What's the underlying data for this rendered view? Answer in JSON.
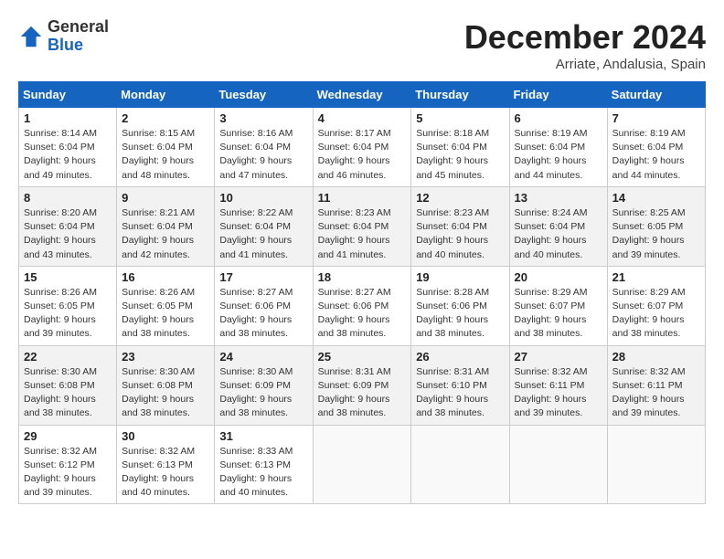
{
  "logo": {
    "general": "General",
    "blue": "Blue"
  },
  "title": "December 2024",
  "location": "Arriate, Andalusia, Spain",
  "weekdays": [
    "Sunday",
    "Monday",
    "Tuesday",
    "Wednesday",
    "Thursday",
    "Friday",
    "Saturday"
  ],
  "weeks": [
    [
      {
        "day": "1",
        "info": "Sunrise: 8:14 AM\nSunset: 6:04 PM\nDaylight: 9 hours and 49 minutes."
      },
      {
        "day": "2",
        "info": "Sunrise: 8:15 AM\nSunset: 6:04 PM\nDaylight: 9 hours and 48 minutes."
      },
      {
        "day": "3",
        "info": "Sunrise: 8:16 AM\nSunset: 6:04 PM\nDaylight: 9 hours and 47 minutes."
      },
      {
        "day": "4",
        "info": "Sunrise: 8:17 AM\nSunset: 6:04 PM\nDaylight: 9 hours and 46 minutes."
      },
      {
        "day": "5",
        "info": "Sunrise: 8:18 AM\nSunset: 6:04 PM\nDaylight: 9 hours and 45 minutes."
      },
      {
        "day": "6",
        "info": "Sunrise: 8:19 AM\nSunset: 6:04 PM\nDaylight: 9 hours and 44 minutes."
      },
      {
        "day": "7",
        "info": "Sunrise: 8:19 AM\nSunset: 6:04 PM\nDaylight: 9 hours and 44 minutes."
      }
    ],
    [
      {
        "day": "8",
        "info": "Sunrise: 8:20 AM\nSunset: 6:04 PM\nDaylight: 9 hours and 43 minutes."
      },
      {
        "day": "9",
        "info": "Sunrise: 8:21 AM\nSunset: 6:04 PM\nDaylight: 9 hours and 42 minutes."
      },
      {
        "day": "10",
        "info": "Sunrise: 8:22 AM\nSunset: 6:04 PM\nDaylight: 9 hours and 41 minutes."
      },
      {
        "day": "11",
        "info": "Sunrise: 8:23 AM\nSunset: 6:04 PM\nDaylight: 9 hours and 41 minutes."
      },
      {
        "day": "12",
        "info": "Sunrise: 8:23 AM\nSunset: 6:04 PM\nDaylight: 9 hours and 40 minutes."
      },
      {
        "day": "13",
        "info": "Sunrise: 8:24 AM\nSunset: 6:04 PM\nDaylight: 9 hours and 40 minutes."
      },
      {
        "day": "14",
        "info": "Sunrise: 8:25 AM\nSunset: 6:05 PM\nDaylight: 9 hours and 39 minutes."
      }
    ],
    [
      {
        "day": "15",
        "info": "Sunrise: 8:26 AM\nSunset: 6:05 PM\nDaylight: 9 hours and 39 minutes."
      },
      {
        "day": "16",
        "info": "Sunrise: 8:26 AM\nSunset: 6:05 PM\nDaylight: 9 hours and 38 minutes."
      },
      {
        "day": "17",
        "info": "Sunrise: 8:27 AM\nSunset: 6:06 PM\nDaylight: 9 hours and 38 minutes."
      },
      {
        "day": "18",
        "info": "Sunrise: 8:27 AM\nSunset: 6:06 PM\nDaylight: 9 hours and 38 minutes."
      },
      {
        "day": "19",
        "info": "Sunrise: 8:28 AM\nSunset: 6:06 PM\nDaylight: 9 hours and 38 minutes."
      },
      {
        "day": "20",
        "info": "Sunrise: 8:29 AM\nSunset: 6:07 PM\nDaylight: 9 hours and 38 minutes."
      },
      {
        "day": "21",
        "info": "Sunrise: 8:29 AM\nSunset: 6:07 PM\nDaylight: 9 hours and 38 minutes."
      }
    ],
    [
      {
        "day": "22",
        "info": "Sunrise: 8:30 AM\nSunset: 6:08 PM\nDaylight: 9 hours and 38 minutes."
      },
      {
        "day": "23",
        "info": "Sunrise: 8:30 AM\nSunset: 6:08 PM\nDaylight: 9 hours and 38 minutes."
      },
      {
        "day": "24",
        "info": "Sunrise: 8:30 AM\nSunset: 6:09 PM\nDaylight: 9 hours and 38 minutes."
      },
      {
        "day": "25",
        "info": "Sunrise: 8:31 AM\nSunset: 6:09 PM\nDaylight: 9 hours and 38 minutes."
      },
      {
        "day": "26",
        "info": "Sunrise: 8:31 AM\nSunset: 6:10 PM\nDaylight: 9 hours and 38 minutes."
      },
      {
        "day": "27",
        "info": "Sunrise: 8:32 AM\nSunset: 6:11 PM\nDaylight: 9 hours and 39 minutes."
      },
      {
        "day": "28",
        "info": "Sunrise: 8:32 AM\nSunset: 6:11 PM\nDaylight: 9 hours and 39 minutes."
      }
    ],
    [
      {
        "day": "29",
        "info": "Sunrise: 8:32 AM\nSunset: 6:12 PM\nDaylight: 9 hours and 39 minutes."
      },
      {
        "day": "30",
        "info": "Sunrise: 8:32 AM\nSunset: 6:13 PM\nDaylight: 9 hours and 40 minutes."
      },
      {
        "day": "31",
        "info": "Sunrise: 8:33 AM\nSunset: 6:13 PM\nDaylight: 9 hours and 40 minutes."
      },
      null,
      null,
      null,
      null
    ]
  ]
}
